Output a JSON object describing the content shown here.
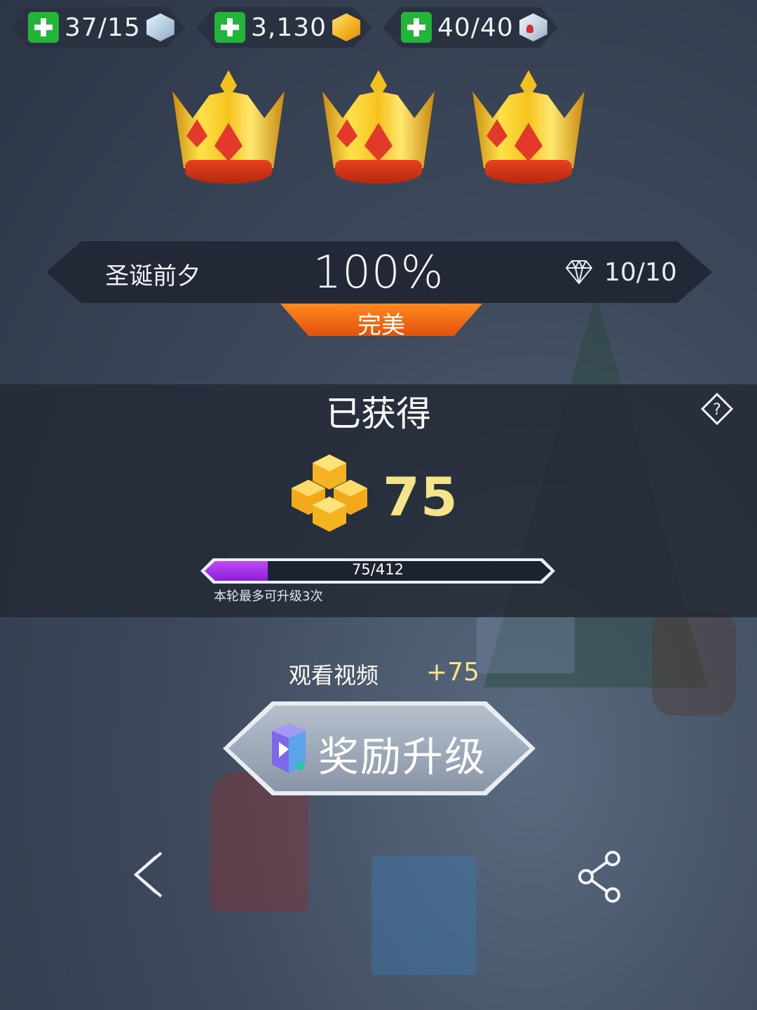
{
  "resources": [
    {
      "value": "37/15",
      "icon": "ice-cube-icon"
    },
    {
      "value": "3,130",
      "icon": "gold-cube-icon"
    },
    {
      "value": "40/40",
      "icon": "heart-cube-icon"
    }
  ],
  "crowns_earned": 3,
  "level": {
    "name": "圣诞前夕",
    "percent": "100%",
    "gems": "10/10",
    "rating": "完美"
  },
  "earned": {
    "title": "已获得",
    "amount": "75",
    "progress_text": "75/412",
    "progress_fraction": 0.182,
    "note": "本轮最多可升级3次"
  },
  "video": {
    "label": "观看视频",
    "bonus": "+75",
    "button_label": "奖励升级"
  },
  "colors": {
    "perfect_orange": "#f06f14",
    "gold_text": "#f6e48b",
    "progress_purple": "#9a2fe0",
    "plus_green": "#22b53a"
  }
}
